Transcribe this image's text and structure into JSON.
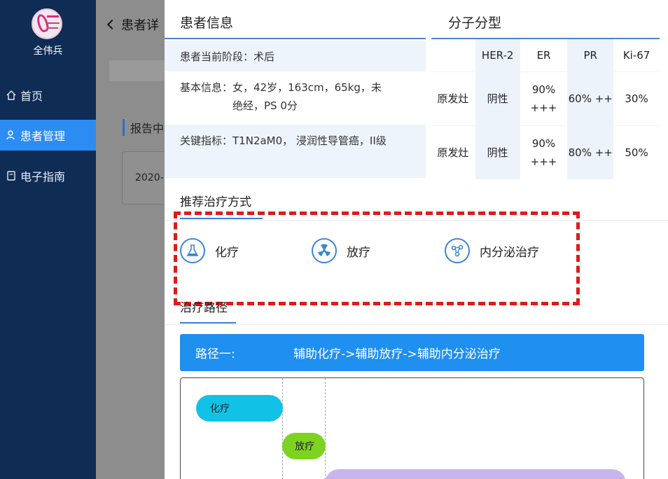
{
  "sidebar": {
    "user_name": "全伟兵",
    "items": [
      {
        "label": "首页",
        "icon": "home-icon"
      },
      {
        "label": "患者管理",
        "icon": "user-icon"
      },
      {
        "label": "电子指南",
        "icon": "book-icon"
      }
    ],
    "active_color": "#2c8cf4",
    "bg_color": "#0f2c55"
  },
  "background_page": {
    "title": "患者详",
    "section": "报告中",
    "date_value": "2020-"
  },
  "panel": {
    "patient_header": "患者信息",
    "molecular_header": "分子分型",
    "info": {
      "stage_label": "患者当前阶段：",
      "stage_value": "术后",
      "basic_label": "基本信息：",
      "basic_value": "女，42岁，163cm，65kg，未绝经，PS 0分",
      "key_label": "关键指标：",
      "key_value": "T1N2aM0， 浸润性导管癌，II级"
    },
    "molecular_table": {
      "headers": [
        "",
        "HER-2",
        "ER",
        "PR",
        "Ki-67"
      ],
      "rows": [
        [
          "原发灶",
          "阴性",
          "90% +++",
          "60% ++",
          "30%"
        ],
        [
          "原发灶",
          "阴性",
          "90% +++",
          "80% ++",
          "50%"
        ]
      ]
    },
    "recommend_title": "推荐治疗方式",
    "treatments": [
      {
        "label": "化疗",
        "icon": "flask-icon"
      },
      {
        "label": "放疗",
        "icon": "radiation-icon"
      },
      {
        "label": "内分泌治疗",
        "icon": "molecule-icon"
      }
    ],
    "path_title": "治疗路径",
    "path_bar": {
      "name": "路径一:",
      "route": "辅助化疗->辅助放疗->辅助内分泌治疗"
    },
    "gantt": {
      "chemo": "化疗",
      "radio": "放疗"
    },
    "colors": {
      "accent": "#1f8ff0",
      "highlight_box": "#e01a1a",
      "chemo_pill": "#12c2e6",
      "radio_pill": "#7ed321",
      "endocrine_pill": "#c7b6ee"
    }
  }
}
